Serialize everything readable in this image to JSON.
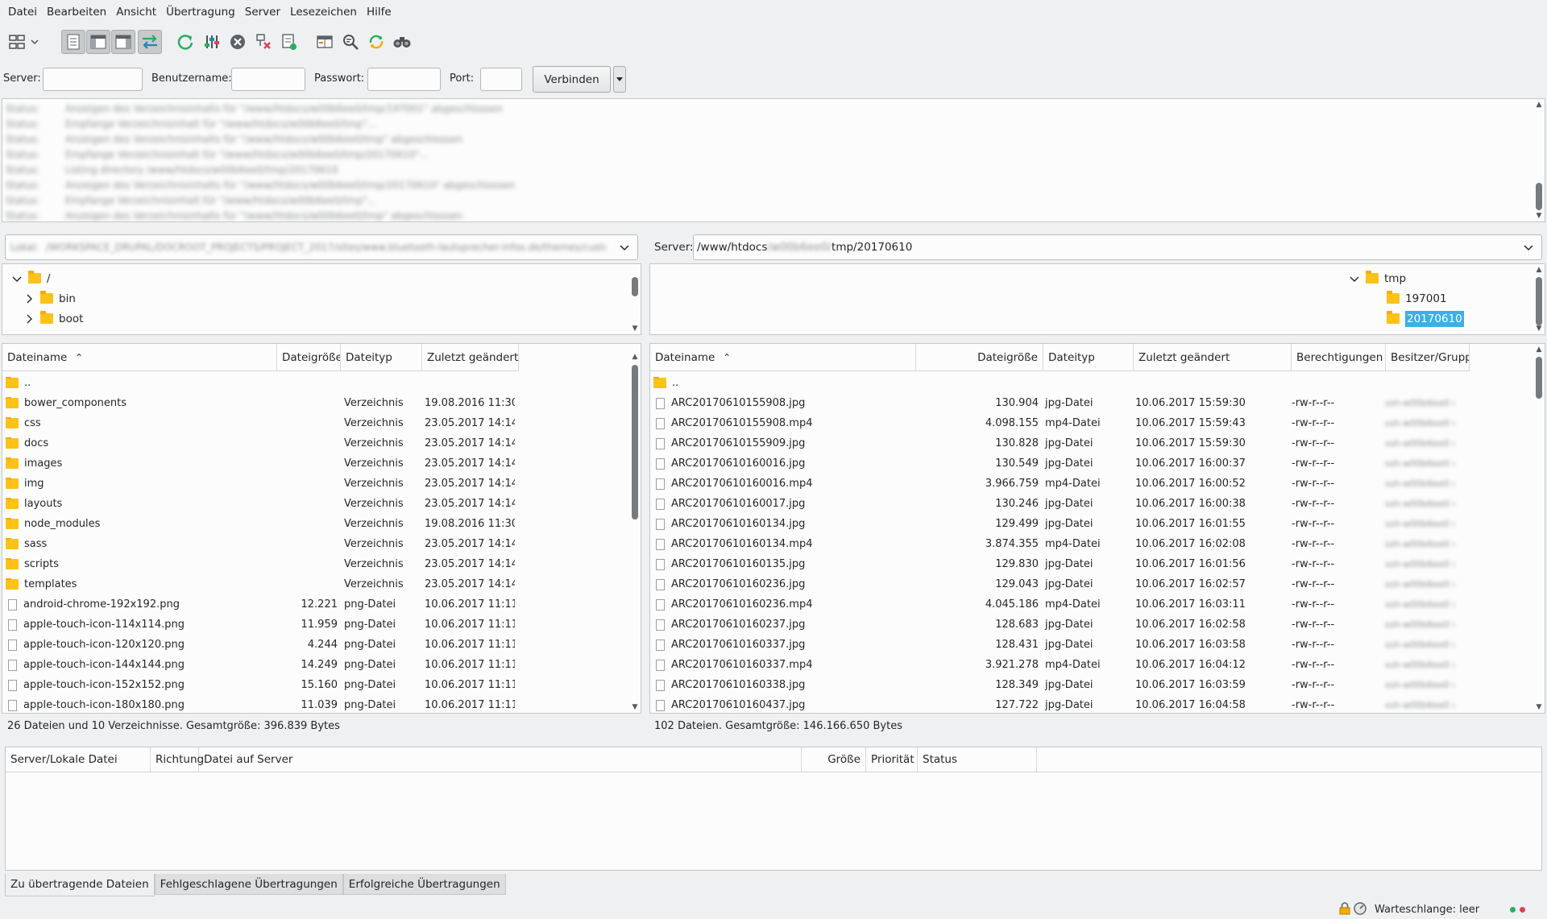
{
  "menu": [
    "Datei",
    "Bearbeiten",
    "Ansicht",
    "Übertragung",
    "Server",
    "Lesezeichen",
    "Hilfe"
  ],
  "toolbar": {
    "icons": [
      "site-manager-icon",
      "dropdown-arrow-icon",
      "message-log-toggle-icon",
      "local-tree-toggle-icon",
      "remote-tree-toggle-icon",
      "transfer-queue-toggle-icon",
      "refresh-icon",
      "process-queue-icon",
      "cancel-operation-icon",
      "disconnect-icon",
      "reconnect-icon",
      "directory-comparison-icon",
      "filename-filter-icon",
      "synchronized-browsing-icon",
      "search-icon"
    ]
  },
  "quickconnect": {
    "server_label": "Server:",
    "user_label": "Benutzername:",
    "pass_label": "Passwort:",
    "port_label": "Port:",
    "server_value": "",
    "user_value": "",
    "pass_value": "",
    "port_value": "",
    "connect_label": "Verbinden"
  },
  "log": {
    "lines": [
      {
        "kind": "Status:",
        "text": "Anzeigen des Verzeichnisinhalts für \"/www/htdocs/w00b6ee0/tmp/197001\" abgeschlossen"
      },
      {
        "kind": "Status:",
        "text": "Empfange Verzeichnisinhalt für \"/www/htdocs/w00b6ee0/tmp\"..."
      },
      {
        "kind": "Status:",
        "text": "Anzeigen des Verzeichnisinhalts für \"/www/htdocs/w00b6ee0/tmp\" abgeschlossen"
      },
      {
        "kind": "Status:",
        "text": "Empfange Verzeichnisinhalt für \"/www/htdocs/w00b6ee0/tmp/20170610\"..."
      },
      {
        "kind": "Status:",
        "text": "Listing directory /www/htdocs/w00b6ee0/tmp/20170610"
      },
      {
        "kind": "Status:",
        "text": "Anzeigen des Verzeichnisinhalts für \"/www/htdocs/w00b6ee0/tmp/20170610\" abgeschlossen"
      },
      {
        "kind": "Status:",
        "text": "Empfange Verzeichnisinhalt für \"/www/htdocs/w00b6ee0/tmp\"..."
      },
      {
        "kind": "Status:",
        "text": "Anzeigen des Verzeichnisinhalts für \"/www/htdocs/w00b6ee0/tmp\" abgeschlossen"
      }
    ]
  },
  "local": {
    "path_label": "Lokal:",
    "path_value": "/WORKSPACE_DRUPAL/DOCROOT_PROJECTS/PROJECT_2017/sites/www.bluetooth-lautsprecher-infos.de/themes/custom/theme",
    "tree": [
      {
        "label": "/",
        "expanded": true,
        "level": 0
      },
      {
        "label": "bin",
        "expanded": false,
        "level": 1
      },
      {
        "label": "boot",
        "expanded": false,
        "level": 1
      }
    ],
    "columns": [
      "Dateiname",
      "Dateigröße",
      "Dateityp",
      "Zuletzt geändert"
    ],
    "rows": [
      {
        "name": "..",
        "size": "",
        "type": "",
        "date": "",
        "folder": true
      },
      {
        "name": "bower_components",
        "size": "",
        "type": "Verzeichnis",
        "date": "19.08.2016 11:30:...",
        "folder": true
      },
      {
        "name": "css",
        "size": "",
        "type": "Verzeichnis",
        "date": "23.05.2017 14:14:...",
        "folder": true
      },
      {
        "name": "docs",
        "size": "",
        "type": "Verzeichnis",
        "date": "23.05.2017 14:14:...",
        "folder": true
      },
      {
        "name": "images",
        "size": "",
        "type": "Verzeichnis",
        "date": "23.05.2017 14:14:...",
        "folder": true
      },
      {
        "name": "img",
        "size": "",
        "type": "Verzeichnis",
        "date": "23.05.2017 14:14:...",
        "folder": true
      },
      {
        "name": "layouts",
        "size": "",
        "type": "Verzeichnis",
        "date": "23.05.2017 14:14:...",
        "folder": true
      },
      {
        "name": "node_modules",
        "size": "",
        "type": "Verzeichnis",
        "date": "19.08.2016 11:30:...",
        "folder": true
      },
      {
        "name": "sass",
        "size": "",
        "type": "Verzeichnis",
        "date": "23.05.2017 14:14:...",
        "folder": true
      },
      {
        "name": "scripts",
        "size": "",
        "type": "Verzeichnis",
        "date": "23.05.2017 14:14:...",
        "folder": true
      },
      {
        "name": "templates",
        "size": "",
        "type": "Verzeichnis",
        "date": "23.05.2017 14:14:...",
        "folder": true
      },
      {
        "name": "android-chrome-192x192.png",
        "size": "12.221",
        "type": "png-Datei",
        "date": "10.06.2017 11:11:...",
        "folder": false
      },
      {
        "name": "apple-touch-icon-114x114.png",
        "size": "11.959",
        "type": "png-Datei",
        "date": "10.06.2017 11:11:...",
        "folder": false
      },
      {
        "name": "apple-touch-icon-120x120.png",
        "size": "4.244",
        "type": "png-Datei",
        "date": "10.06.2017 11:11:...",
        "folder": false
      },
      {
        "name": "apple-touch-icon-144x144.png",
        "size": "14.249",
        "type": "png-Datei",
        "date": "10.06.2017 11:11:...",
        "folder": false
      },
      {
        "name": "apple-touch-icon-152x152.png",
        "size": "15.160",
        "type": "png-Datei",
        "date": "10.06.2017 11:11:...",
        "folder": false
      },
      {
        "name": "apple-touch-icon-180x180.png",
        "size": "11.039",
        "type": "png-Datei",
        "date": "10.06.2017 11:11:...",
        "folder": false
      }
    ],
    "status": "26 Dateien und 10 Verzeichnisse. Gesamtgröße: 396.839 Bytes"
  },
  "remote": {
    "path_label": "Server:",
    "path_prefix": "/www/htdocs",
    "path_hidden": "/w00b6ee0/",
    "path_suffix": "tmp/20170610",
    "tree": [
      {
        "label": "tmp",
        "expanded": true,
        "level": 0,
        "selected": false
      },
      {
        "label": "197001",
        "expanded": false,
        "level": 1,
        "selected": false
      },
      {
        "label": "20170610",
        "expanded": false,
        "level": 1,
        "selected": true
      }
    ],
    "columns": [
      "Dateiname",
      "Dateigröße",
      "Dateityp",
      "Zuletzt geändert",
      "Berechtigungen",
      "Besitzer/Gruppe"
    ],
    "rows": [
      {
        "name": "..",
        "size": "",
        "type": "",
        "date": "",
        "perm": "",
        "owner": "",
        "folder": true
      },
      {
        "name": "ARC20170610155908.jpg",
        "size": "130.904",
        "type": "jpg-Datei",
        "date": "10.06.2017 15:59:30",
        "perm": "-rw-r--r--",
        "owner": "ssh-w00b6ee0 w00b6ee0",
        "folder": false
      },
      {
        "name": "ARC20170610155908.mp4",
        "size": "4.098.155",
        "type": "mp4-Datei",
        "date": "10.06.2017 15:59:43",
        "perm": "-rw-r--r--",
        "owner": "ssh-w00b6ee0 w00b6ee0",
        "folder": false
      },
      {
        "name": "ARC20170610155909.jpg",
        "size": "130.828",
        "type": "jpg-Datei",
        "date": "10.06.2017 15:59:30",
        "perm": "-rw-r--r--",
        "owner": "ssh-w00b6ee0 w00b6ee0",
        "folder": false
      },
      {
        "name": "ARC20170610160016.jpg",
        "size": "130.549",
        "type": "jpg-Datei",
        "date": "10.06.2017 16:00:37",
        "perm": "-rw-r--r--",
        "owner": "ssh-w00b6ee0 w00b6ee0",
        "folder": false
      },
      {
        "name": "ARC20170610160016.mp4",
        "size": "3.966.759",
        "type": "mp4-Datei",
        "date": "10.06.2017 16:00:52",
        "perm": "-rw-r--r--",
        "owner": "ssh-w00b6ee0 w00b6ee0",
        "folder": false
      },
      {
        "name": "ARC20170610160017.jpg",
        "size": "130.246",
        "type": "jpg-Datei",
        "date": "10.06.2017 16:00:38",
        "perm": "-rw-r--r--",
        "owner": "ssh-w00b6ee0 w00b6ee0",
        "folder": false
      },
      {
        "name": "ARC20170610160134.jpg",
        "size": "129.499",
        "type": "jpg-Datei",
        "date": "10.06.2017 16:01:55",
        "perm": "-rw-r--r--",
        "owner": "ssh-w00b6ee0 w00b6ee0",
        "folder": false
      },
      {
        "name": "ARC20170610160134.mp4",
        "size": "3.874.355",
        "type": "mp4-Datei",
        "date": "10.06.2017 16:02:08",
        "perm": "-rw-r--r--",
        "owner": "ssh-w00b6ee0 w00b6ee0",
        "folder": false
      },
      {
        "name": "ARC20170610160135.jpg",
        "size": "129.830",
        "type": "jpg-Datei",
        "date": "10.06.2017 16:01:56",
        "perm": "-rw-r--r--",
        "owner": "ssh-w00b6ee0 w00b6ee0",
        "folder": false
      },
      {
        "name": "ARC20170610160236.jpg",
        "size": "129.043",
        "type": "jpg-Datei",
        "date": "10.06.2017 16:02:57",
        "perm": "-rw-r--r--",
        "owner": "ssh-w00b6ee0 w00b6ee0",
        "folder": false
      },
      {
        "name": "ARC20170610160236.mp4",
        "size": "4.045.186",
        "type": "mp4-Datei",
        "date": "10.06.2017 16:03:11",
        "perm": "-rw-r--r--",
        "owner": "ssh-w00b6ee0 w00b6ee0",
        "folder": false
      },
      {
        "name": "ARC20170610160237.jpg",
        "size": "128.683",
        "type": "jpg-Datei",
        "date": "10.06.2017 16:02:58",
        "perm": "-rw-r--r--",
        "owner": "ssh-w00b6ee0 w00b6ee0",
        "folder": false
      },
      {
        "name": "ARC20170610160337.jpg",
        "size": "128.431",
        "type": "jpg-Datei",
        "date": "10.06.2017 16:03:58",
        "perm": "-rw-r--r--",
        "owner": "ssh-w00b6ee0 w00b6ee0",
        "folder": false
      },
      {
        "name": "ARC20170610160337.mp4",
        "size": "3.921.278",
        "type": "mp4-Datei",
        "date": "10.06.2017 16:04:12",
        "perm": "-rw-r--r--",
        "owner": "ssh-w00b6ee0 w00b6ee0",
        "folder": false
      },
      {
        "name": "ARC20170610160338.jpg",
        "size": "128.349",
        "type": "jpg-Datei",
        "date": "10.06.2017 16:03:59",
        "perm": "-rw-r--r--",
        "owner": "ssh-w00b6ee0 w00b6ee0",
        "folder": false
      },
      {
        "name": "ARC20170610160437.jpg",
        "size": "127.722",
        "type": "jpg-Datei",
        "date": "10.06.2017 16:04:58",
        "perm": "-rw-r--r--",
        "owner": "ssh-w00b6ee0 w00b6ee0",
        "folder": false
      }
    ],
    "status": "102 Dateien. Gesamtgröße: 146.166.650 Bytes"
  },
  "queue": {
    "columns": [
      "Server/Lokale Datei",
      "Richtung",
      "Datei auf Server",
      "Größe",
      "Priorität",
      "Status"
    ]
  },
  "tabs": [
    "Zu übertragende Dateien",
    "Fehlgeschlagene Übertragungen",
    "Erfolgreiche Übertragungen"
  ],
  "statusbar": {
    "queue_text": "Warteschlange: leer"
  },
  "colors": {
    "selection": "#3daee9",
    "folder": "#fcc218",
    "accent_green": "#27ae60",
    "accent_red": "#da4453"
  }
}
